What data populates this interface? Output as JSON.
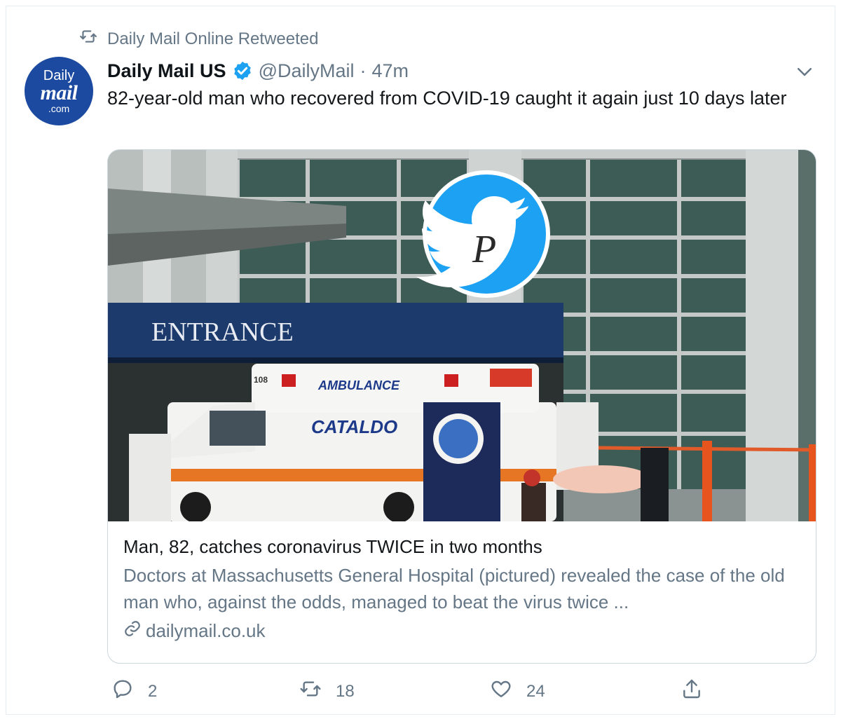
{
  "retweet": {
    "text": "Daily Mail Online Retweeted",
    "icon": "retweet-icon"
  },
  "author": {
    "avatar": {
      "line1": "Daily",
      "line2": "mail",
      "line3": ".com"
    },
    "display_name": "Daily Mail US",
    "verified_icon": "verified-badge-icon",
    "handle": "@DailyMail",
    "separator": "·",
    "timestamp": "47m"
  },
  "tweet_text": "82-year-old man who recovered from COVID-19 caught it again just 10 days later",
  "card": {
    "image": {
      "sign_text": "ENTRANCE",
      "ambulance_label": "AMBULANCE",
      "ambulance_brand": "CATALDO",
      "unit_number": "108",
      "overlay_icon": "twitter-bird-icon",
      "overlay_letter": "P"
    },
    "title": "Man, 82, catches coronavirus TWICE in two months",
    "description": "Doctors at Massachusetts General Hospital (pictured) revealed the case of the old man who, against the odds, managed to beat the virus twice ...",
    "domain": "dailymail.co.uk"
  },
  "actions": {
    "reply_count": "2",
    "retweet_count": "18",
    "like_count": "24"
  },
  "colors": {
    "accent": "#1da1f2",
    "muted": "#657786",
    "text": "#14171a",
    "border": "#ccd6dd"
  }
}
